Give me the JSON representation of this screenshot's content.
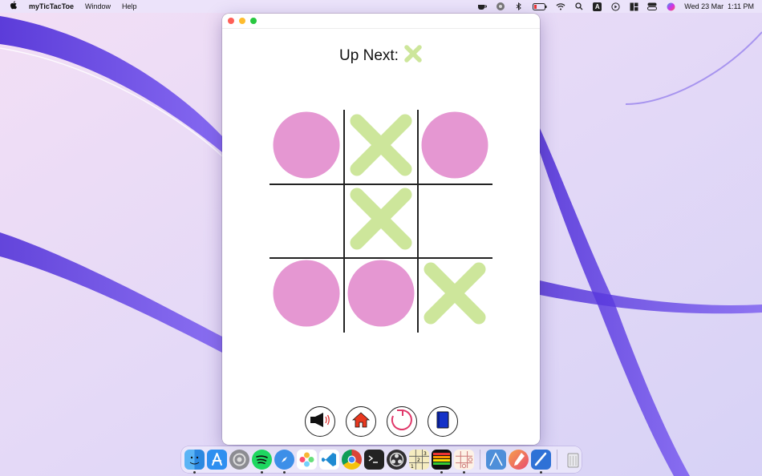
{
  "menubar": {
    "apple_icon": "apple-icon",
    "app_name": "myTicTacToe",
    "menus": [
      "Window",
      "Help"
    ],
    "status_icons": [
      "coffee-icon",
      "hotspot-icon",
      "bluetooth-icon",
      "battery-icon",
      "wifi-icon",
      "search-icon",
      "keyboard-input-icon",
      "play-icon",
      "layout-icon",
      "control-center-icon",
      "siri-icon"
    ],
    "input_source": "A",
    "datetime": "Wed 23 Mar  1:11 PM"
  },
  "window": {
    "up_next_label": "Up Next:",
    "up_next_mark": "X",
    "board": [
      "O",
      "X",
      "O",
      "",
      "X",
      "",
      "O",
      "O",
      "X"
    ],
    "toolbar": [
      {
        "name": "sound-button",
        "icon": "speaker-icon"
      },
      {
        "name": "home-button",
        "icon": "home-icon"
      },
      {
        "name": "restart-button",
        "icon": "restart-icon"
      },
      {
        "name": "book-button",
        "icon": "book-icon"
      }
    ]
  },
  "colors": {
    "o_mark": "#e597d2",
    "x_mark": "#cde69b",
    "grid": "#222222",
    "home_icon": "#e8381f",
    "restart_icon": "#e0386a",
    "book_icon": "#1432c8"
  },
  "dock": {
    "apps": [
      "Finder",
      "App Store",
      "System Preferences",
      "Spotify",
      "Safari",
      "Photos",
      "Visual Studio Code",
      "Chrome",
      "Terminal",
      "OBS",
      "Sudoku",
      "Tetris",
      "myTicTacToe",
      "Instruments",
      "Pixelmator",
      "Xcode",
      "Trash"
    ]
  }
}
